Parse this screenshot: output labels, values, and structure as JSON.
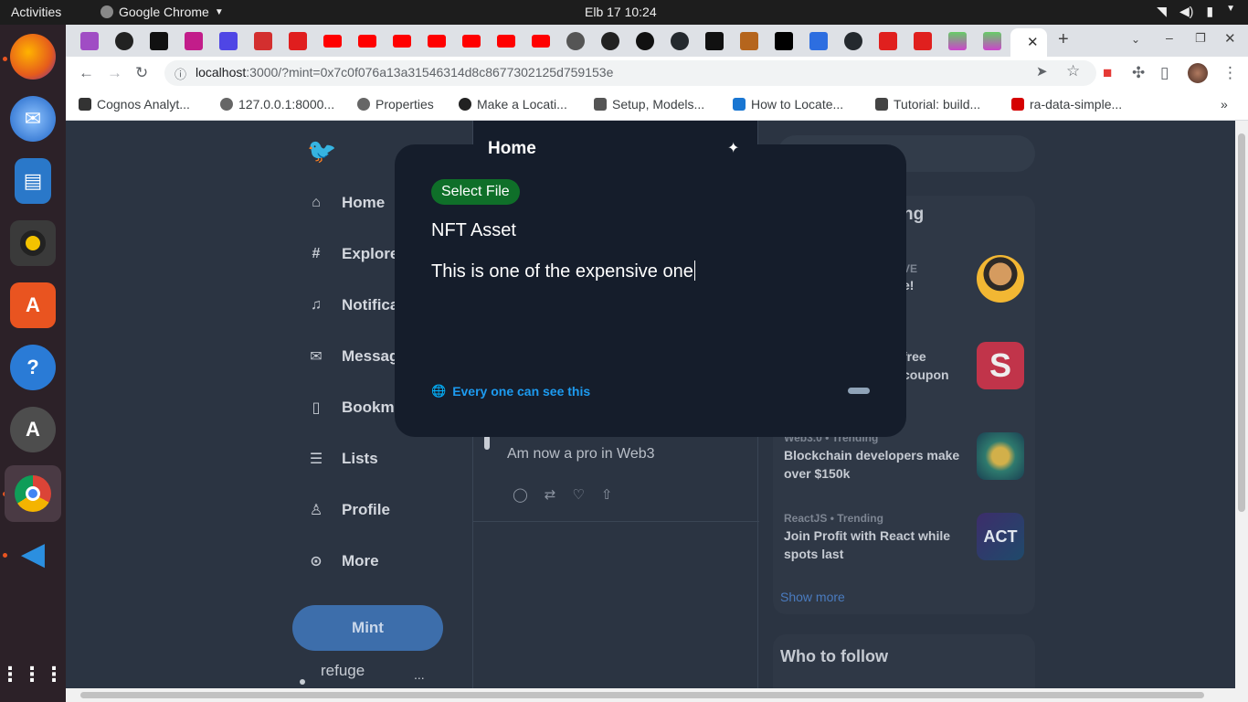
{
  "topbar": {
    "activities": "Activities",
    "app_name": "Google Chrome",
    "clock": "Elb 17  10:24"
  },
  "browser": {
    "url_host": "localhost",
    "url_rest": ":3000/?mint=0x7c0f076a13a31546314d8c8677302125d759153e",
    "bookmarks": [
      {
        "label": "Cognos Analyt..."
      },
      {
        "label": "127.0.0.1:8000..."
      },
      {
        "label": "Properties"
      },
      {
        "label": "Make a Locati..."
      },
      {
        "label": "Setup, Models..."
      },
      {
        "label": "How to Locate..."
      },
      {
        "label": "Tutorial: build..."
      },
      {
        "label": "ra-data-simple..."
      }
    ],
    "bookmarks_overflow": "»"
  },
  "sidebar": {
    "items": [
      {
        "label": "Home"
      },
      {
        "label": "Explore"
      },
      {
        "label": "Notifica"
      },
      {
        "label": "Message"
      },
      {
        "label": "Bookma"
      },
      {
        "label": "Lists"
      },
      {
        "label": "Profile"
      },
      {
        "label": "More"
      }
    ],
    "mint_button": "Mint",
    "account_name": "refuge",
    "account_more": "..."
  },
  "feed": {
    "tweet_text": "Am now a pro in Web3"
  },
  "trends": {
    "heading_fragment": "ng",
    "items": [
      {
        "meta": "VE",
        "title": "e!"
      },
      {
        "meta": "",
        "title": "free\ncoupon"
      },
      {
        "meta": "Web3.0 • Trending",
        "title": "Blockchain developers make over $150k"
      },
      {
        "meta": "ReactJS • Trending",
        "title": "Join Profit with React while spots last"
      }
    ],
    "show_more": "Show more"
  },
  "who_to_follow": {
    "title": "Who to follow"
  },
  "modal": {
    "tab_title": "Home",
    "select_file": "Select File",
    "nft_name": "NFT Asset",
    "nft_description": "This is one of the expensive one",
    "visibility": "Every one can see this"
  },
  "colors": {
    "accent": "#1d9bf0",
    "select_file_bg": "#0f6f29",
    "modal_bg": "#151d2b",
    "page_bg": "#2b3442"
  }
}
